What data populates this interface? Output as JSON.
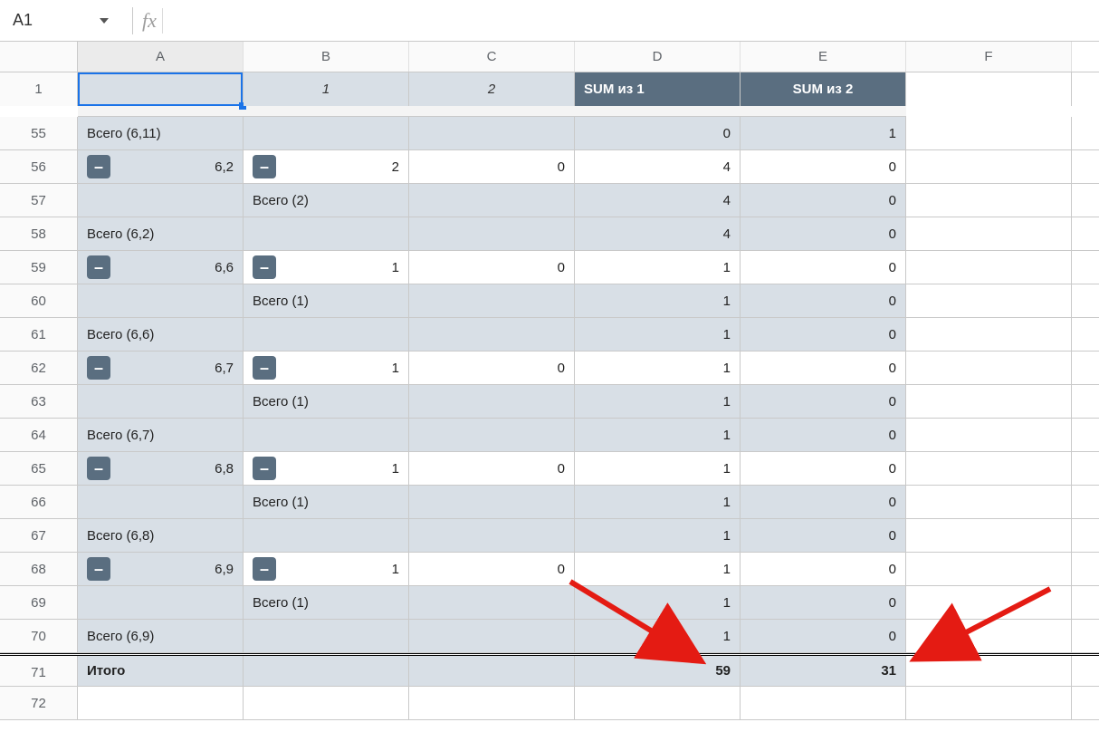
{
  "nameBox": "A1",
  "fxLabel": "fx",
  "fxValue": "",
  "columns": [
    "A",
    "B",
    "C",
    "D",
    "E",
    "F"
  ],
  "headerRow": {
    "num": "1",
    "B": "1",
    "C": "2",
    "D": "SUM из 1",
    "E": "SUM из 2"
  },
  "rows": [
    {
      "num": "55",
      "type": "total",
      "A": "Всего (6,11)",
      "D": "0",
      "E": "1"
    },
    {
      "num": "56",
      "type": "detail",
      "Aval": "6,2",
      "Bval": "2",
      "C": "0",
      "D": "4",
      "E": "0"
    },
    {
      "num": "57",
      "type": "subB",
      "B": "Всего (2)",
      "D": "4",
      "E": "0"
    },
    {
      "num": "58",
      "type": "total",
      "A": "Всего (6,2)",
      "D": "4",
      "E": "0"
    },
    {
      "num": "59",
      "type": "detail",
      "Aval": "6,6",
      "Bval": "1",
      "C": "0",
      "D": "1",
      "E": "0"
    },
    {
      "num": "60",
      "type": "subB",
      "B": "Всего (1)",
      "D": "1",
      "E": "0"
    },
    {
      "num": "61",
      "type": "total",
      "A": "Всего (6,6)",
      "D": "1",
      "E": "0"
    },
    {
      "num": "62",
      "type": "detail",
      "Aval": "6,7",
      "Bval": "1",
      "C": "0",
      "D": "1",
      "E": "0"
    },
    {
      "num": "63",
      "type": "subB",
      "B": "Всего (1)",
      "D": "1",
      "E": "0"
    },
    {
      "num": "64",
      "type": "total",
      "A": "Всего (6,7)",
      "D": "1",
      "E": "0"
    },
    {
      "num": "65",
      "type": "detail",
      "Aval": "6,8",
      "Bval": "1",
      "C": "0",
      "D": "1",
      "E": "0"
    },
    {
      "num": "66",
      "type": "subB",
      "B": "Всего (1)",
      "D": "1",
      "E": "0"
    },
    {
      "num": "67",
      "type": "total",
      "A": "Всего (6,8)",
      "D": "1",
      "E": "0"
    },
    {
      "num": "68",
      "type": "detail",
      "Aval": "6,9",
      "Bval": "1",
      "C": "0",
      "D": "1",
      "E": "0"
    },
    {
      "num": "69",
      "type": "subB",
      "B": "Всего (1)",
      "D": "1",
      "E": "0"
    },
    {
      "num": "70",
      "type": "total",
      "A": "Всего (6,9)",
      "D": "1",
      "E": "0"
    },
    {
      "num": "71",
      "type": "grand",
      "A": "Итого",
      "D": "59",
      "E": "31"
    },
    {
      "num": "72",
      "type": "blank"
    }
  ],
  "icons": {
    "collapse": "–"
  }
}
